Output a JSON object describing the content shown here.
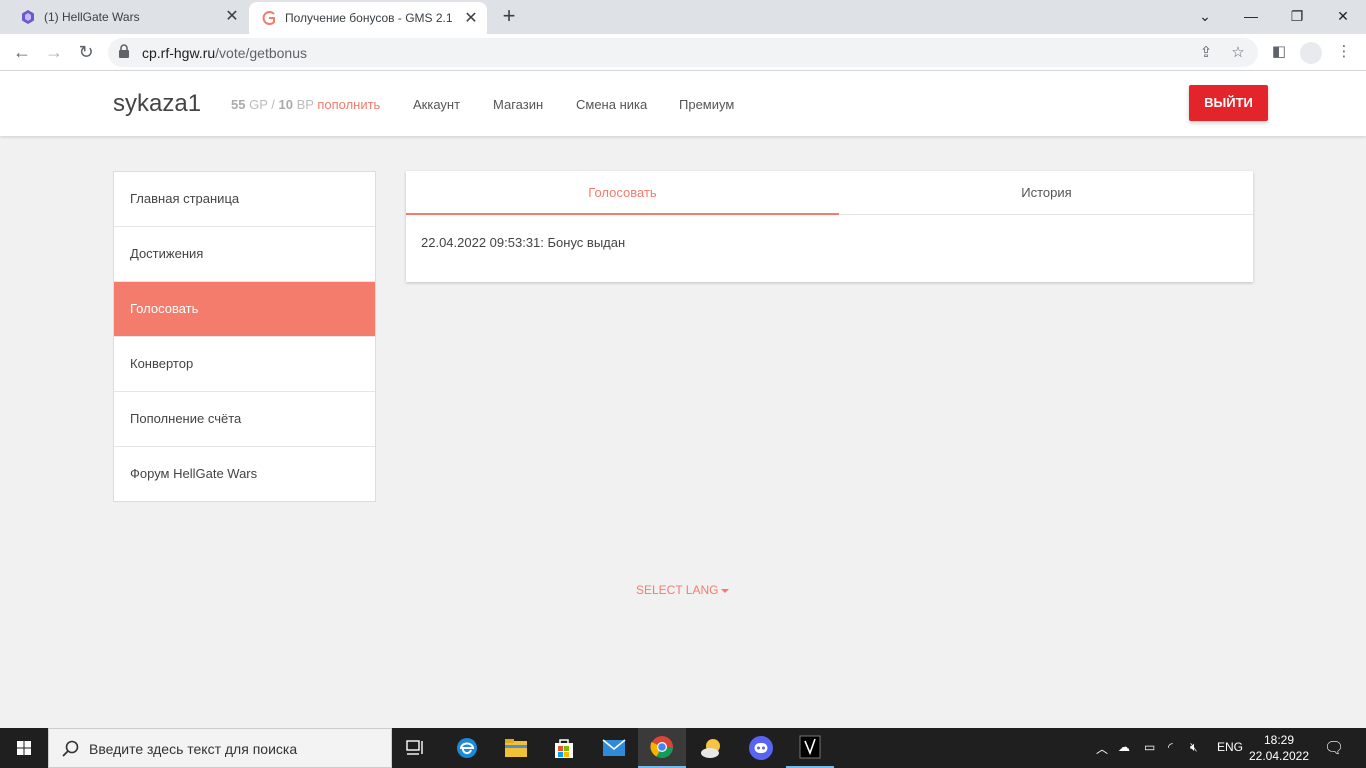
{
  "browser": {
    "tabs": [
      {
        "title": "(1) HellGate Wars"
      },
      {
        "title": "Получение бонусов - GMS 2.1"
      }
    ],
    "url_host": "cp.rf-hgw.ru",
    "url_path": "/vote/getbonus"
  },
  "header": {
    "username": "sykaza1",
    "gp": "55",
    "gp_unit": "GP /",
    "bp": "10",
    "bp_unit": "BP",
    "topup": "пополнить",
    "nav": [
      "Аккаунт",
      "Магазин",
      "Смена ника",
      "Премиум"
    ],
    "logout": "ВЫЙТИ"
  },
  "sidebar": {
    "items": [
      {
        "label": "Главная страница"
      },
      {
        "label": "Достижения"
      },
      {
        "label": "Голосовать"
      },
      {
        "label": "Конвертор"
      },
      {
        "label": "Пополнение счёта"
      },
      {
        "label": "Форум HellGate Wars"
      }
    ]
  },
  "main": {
    "tabs": [
      {
        "label": "Голосовать"
      },
      {
        "label": "История"
      }
    ],
    "message": "22.04.2022 09:53:31: Бонус выдан"
  },
  "footer": {
    "select_lang": "SELECT LANG"
  },
  "taskbar": {
    "search_placeholder": "Введите здесь текст для поиска",
    "lang": "ENG",
    "time": "18:29",
    "date": "22.04.2022"
  },
  "colors": {
    "accent": "#f47c6c",
    "logout": "#e3242b"
  }
}
